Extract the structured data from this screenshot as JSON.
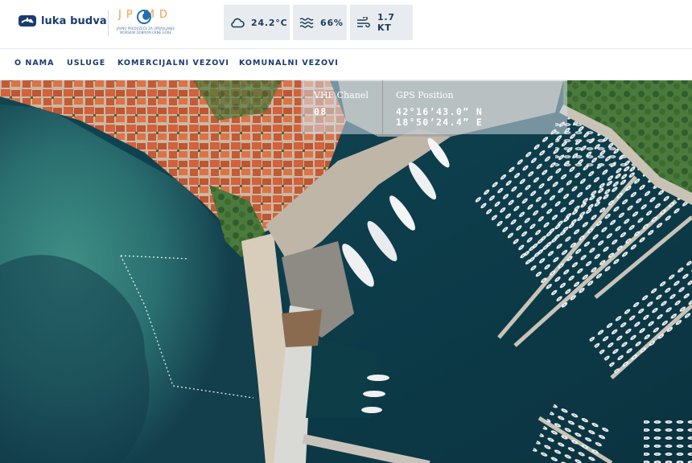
{
  "header": {
    "brand": "luka budva",
    "partner_logo_letters": "JP MD",
    "partner_logo_subtext": "JAVNO PREDUZEĆE ZA UPRAVLJANJE MORSKIM DOBROM CRNE GORE"
  },
  "weather": {
    "temperature": "24.2°C",
    "waves": "66%",
    "wind": "1.7 KT",
    "icons": {
      "temperature": "cloud-icon",
      "waves": "waves-icon",
      "wind": "wind-icon"
    }
  },
  "nav": {
    "items": [
      {
        "label": "O NAMA"
      },
      {
        "label": "USLUGE"
      },
      {
        "label": "KOMERCIJALNI VEZOVI"
      },
      {
        "label": "KOMUNALNI VEZOVI"
      }
    ]
  },
  "marina_info": {
    "vhf_label": "VHF Chanel",
    "vhf_value": "08",
    "gps_label": "GPS Position",
    "gps_lat": "42°16’43.0” N",
    "gps_lon": "18°50’24.4” E"
  },
  "colors": {
    "brand_navy": "#1a3c6e",
    "accent_orange": "#e8a24a",
    "weather_tile": "#e8ecf0",
    "sea_deep": "#0f3b48"
  }
}
